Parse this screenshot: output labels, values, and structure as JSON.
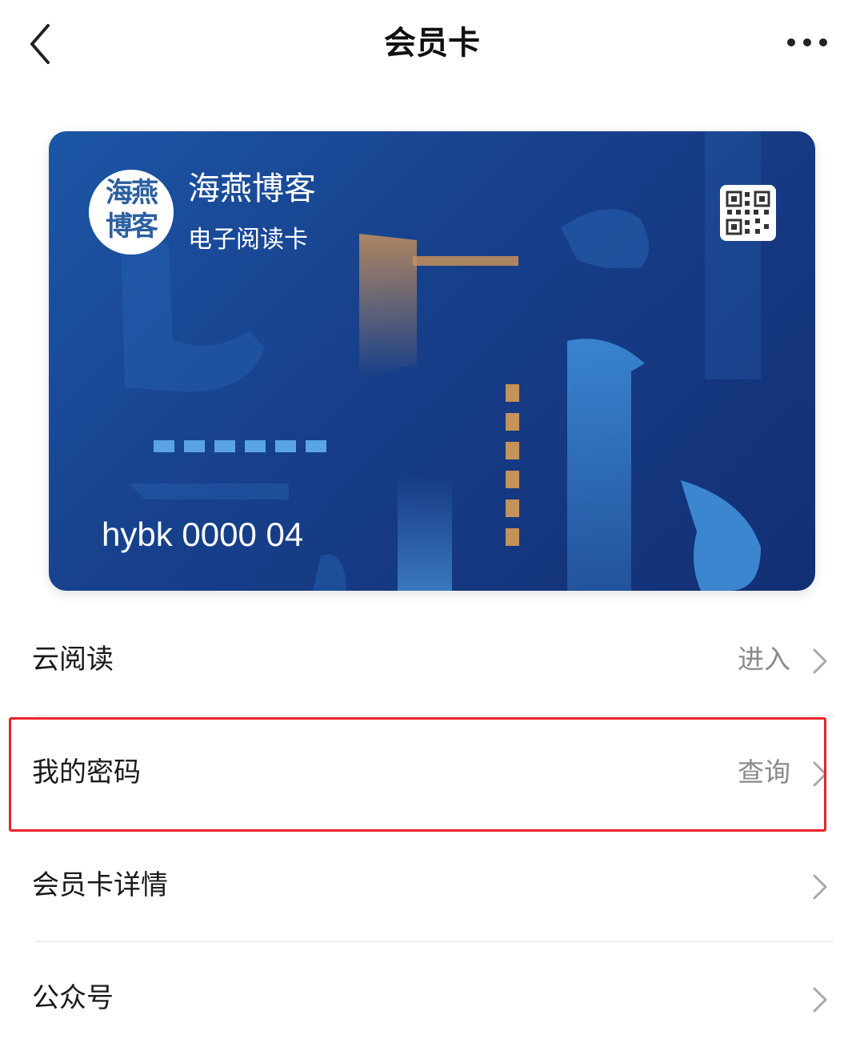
{
  "header": {
    "title": "会员卡",
    "back_icon": "chevron-left-icon",
    "more_icon": "more-dots-icon"
  },
  "card": {
    "logo_text_line1": "海燕",
    "logo_text_line2": "博客",
    "name": "海燕博客",
    "subtitle": "电子阅读卡",
    "number": "hybk 0000 04",
    "qr_icon": "qr-code-icon",
    "colors": {
      "background": "#173f8a",
      "accent_light": "#3b86cf",
      "accent_orange": "#c8905a"
    }
  },
  "list": {
    "items": [
      {
        "label": "云阅读",
        "action": "进入"
      },
      {
        "label": "我的密码",
        "action": "查询"
      },
      {
        "label": "会员卡详情",
        "action": ""
      },
      {
        "label": "公众号",
        "action": ""
      }
    ]
  },
  "colors": {
    "highlight": "#e8242a",
    "secondary_text": "#8a8a8a"
  }
}
